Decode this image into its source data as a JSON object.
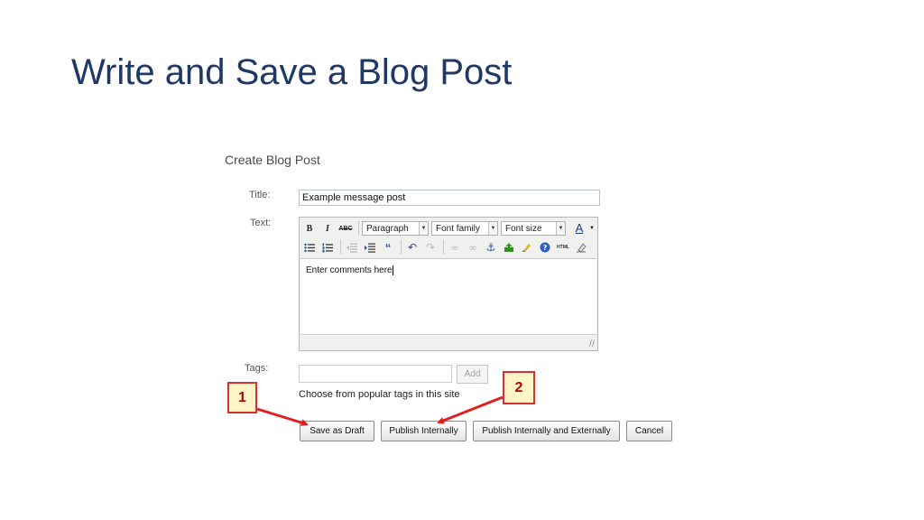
{
  "slide": {
    "title": "Write and Save a Blog Post"
  },
  "form": {
    "heading": "Create Blog Post",
    "title_label": "Title:",
    "title_value": "Example message post",
    "text_label": "Text:",
    "editor": {
      "bold": "B",
      "italic": "I",
      "strike": "ABC",
      "format_select": "Paragraph",
      "font_family_select": "Font family",
      "font_size_select": "Font size",
      "font_color": "A",
      "content": "Enter comments here"
    },
    "tags_label": "Tags:",
    "tags_placeholder": "",
    "add_label": "Add",
    "popular_tags_label": "Choose from popular tags in this site"
  },
  "buttons": {
    "save_draft": "Save as Draft",
    "publish_internal": "Publish Internally",
    "publish_both": "Publish Internally and Externally",
    "cancel": "Cancel"
  },
  "callouts": {
    "one": "1",
    "two": "2"
  },
  "colors": {
    "title": "#1f3864",
    "callout_border": "#d8312b",
    "callout_fill": "#fff5c9",
    "arrow": "#e02020"
  }
}
